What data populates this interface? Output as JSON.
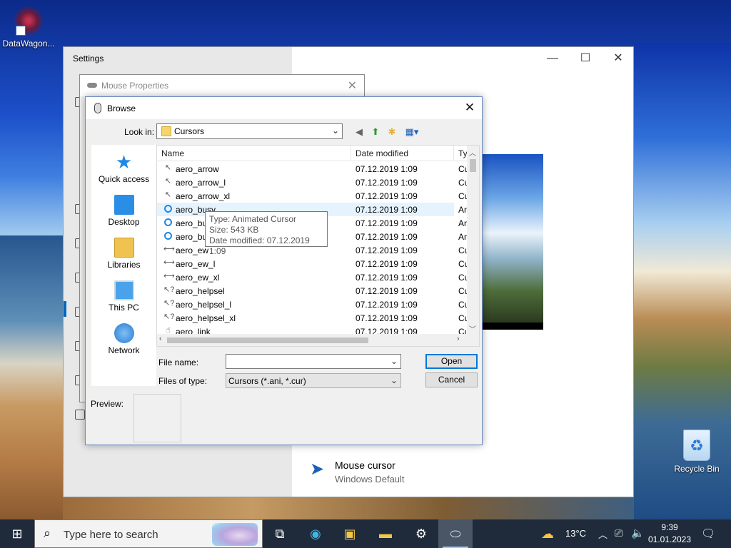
{
  "desktop": {
    "icons": [
      {
        "label": "DataWagon..."
      },
      {
        "label": "Recycle Bin"
      }
    ]
  },
  "settings": {
    "title": "Settings",
    "minimize": "—",
    "maximize": "☐",
    "close": "✕",
    "mouse_cursor": {
      "title": "Mouse cursor",
      "value": "Windows Default"
    }
  },
  "mouse_properties": {
    "title": "Mouse Properties",
    "close": "✕"
  },
  "browse": {
    "title": "Browse",
    "close": "✕",
    "look_in_label": "Look in:",
    "look_in_value": "Cursors",
    "places": [
      {
        "label": "Quick access"
      },
      {
        "label": "Desktop"
      },
      {
        "label": "Libraries"
      },
      {
        "label": "This PC"
      },
      {
        "label": "Network"
      }
    ],
    "columns": {
      "name": "Name",
      "date": "Date modified",
      "type": "Ty"
    },
    "files": [
      {
        "name": "aero_arrow",
        "date": "07.12.2019 1:09",
        "type": "Cu",
        "icon": "arrow"
      },
      {
        "name": "aero_arrow_l",
        "date": "07.12.2019 1:09",
        "type": "Cu",
        "icon": "arrow"
      },
      {
        "name": "aero_arrow_xl",
        "date": "07.12.2019 1:09",
        "type": "Cu",
        "icon": "arrow"
      },
      {
        "name": "aero_busy",
        "date": "07.12.2019 1:09",
        "type": "An",
        "icon": "busy"
      },
      {
        "name": "aero_bu",
        "date": "07.12.2019 1:09",
        "type": "An",
        "icon": "busy"
      },
      {
        "name": "aero_bu",
        "date": "07.12.2019 1:09",
        "type": "An",
        "icon": "busy"
      },
      {
        "name": "aero_ew",
        "date": "07.12.2019 1:09",
        "type": "Cu",
        "icon": "ew"
      },
      {
        "name": "aero_ew_l",
        "date": "07.12.2019 1:09",
        "type": "Cu",
        "icon": "ew"
      },
      {
        "name": "aero_ew_xl",
        "date": "07.12.2019 1:09",
        "type": "Cu",
        "icon": "ew"
      },
      {
        "name": "aero_helpsel",
        "date": "07.12.2019 1:09",
        "type": "Cu",
        "icon": "help"
      },
      {
        "name": "aero_helpsel_l",
        "date": "07.12.2019 1:09",
        "type": "Cu",
        "icon": "help"
      },
      {
        "name": "aero_helpsel_xl",
        "date": "07.12.2019 1:09",
        "type": "Cu",
        "icon": "help"
      },
      {
        "name": "aero_link",
        "date": "07.12.2019 1:09",
        "type": "Cu",
        "icon": "link"
      }
    ],
    "tooltip": {
      "type": "Type: Animated Cursor",
      "size": "Size: 543 KB",
      "date": "Date modified: 07.12.2019 1:09"
    },
    "file_name_label": "File name:",
    "file_name_value": "",
    "files_of_type_label": "Files of type:",
    "files_of_type_value": "Cursors (*.ani, *.cur)",
    "open_button": "Open",
    "cancel_button": "Cancel",
    "preview_label": "Preview:"
  },
  "taskbar": {
    "search_placeholder": "Type here to search",
    "weather_temp": "13°C",
    "time": "9:39",
    "date": "01.01.2023"
  },
  "colors": {
    "accent": "#0078d7",
    "taskbar": "#1f2a3a"
  }
}
